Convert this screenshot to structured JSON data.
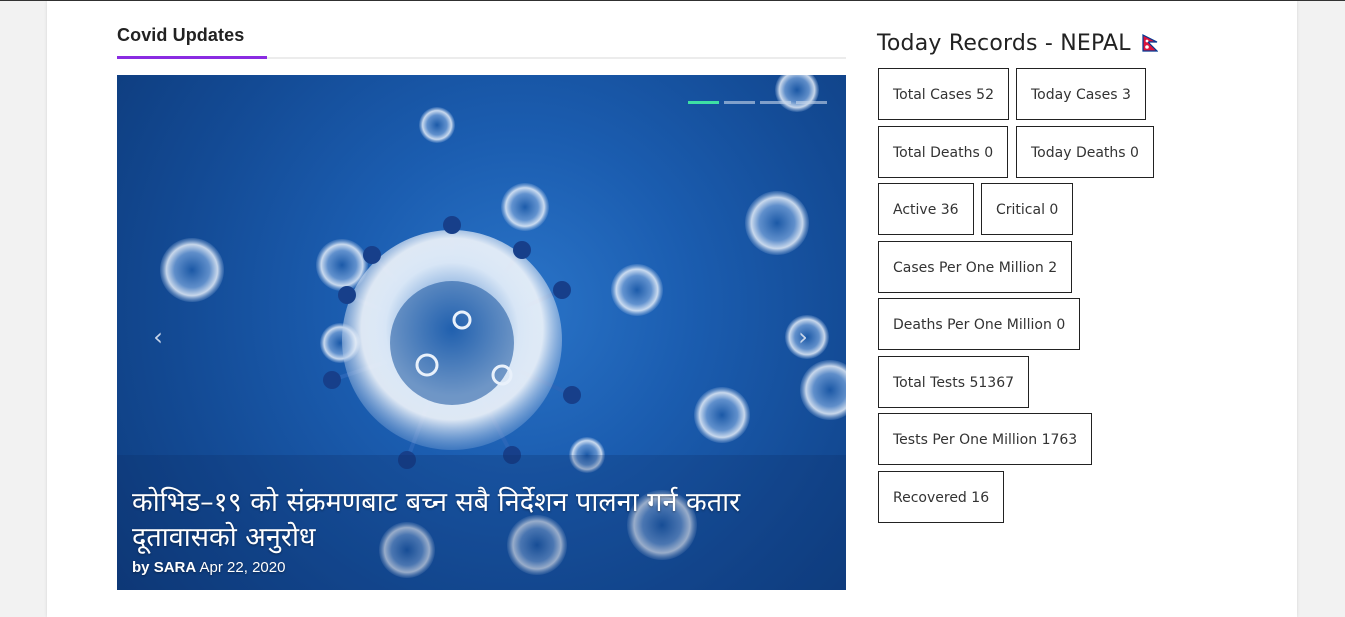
{
  "section": {
    "title": "Covid Updates",
    "accent_color": "#8a2be2"
  },
  "slider": {
    "slide_count": 4,
    "active_index": 0,
    "headline": "कोभिड–१९ को संक्रमणबाट बच्न सबै निर्देशन पालना गर्न कतार दूतावासको अनुरोध",
    "by_label": "by",
    "author": "SARA",
    "date": "Apr 22, 2020",
    "prev_icon": "chevron-left-icon",
    "next_icon": "chevron-right-icon",
    "active_dot_color": "#3ee0a4"
  },
  "records": {
    "title": "Today Records - NEPAL",
    "flag_icon": "nepal-flag-icon",
    "stats": [
      {
        "label": "Total Cases",
        "value": "52"
      },
      {
        "label": "Today Cases",
        "value": "3"
      },
      {
        "label": "Total Deaths",
        "value": "0"
      },
      {
        "label": "Today Deaths",
        "value": "0"
      },
      {
        "label": "Active",
        "value": "36"
      },
      {
        "label": "Critical",
        "value": "0"
      },
      {
        "label": "Cases Per One Million",
        "value": "2"
      },
      {
        "label": "Deaths Per One Million",
        "value": "0"
      },
      {
        "label": "Total Tests",
        "value": "51367"
      },
      {
        "label": "Tests Per One Million",
        "value": "1763"
      },
      {
        "label": "Recovered",
        "value": "16"
      }
    ]
  }
}
